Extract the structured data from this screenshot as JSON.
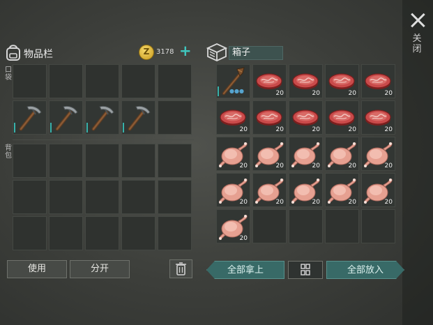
{
  "sidebar": {
    "close_label": "关闭",
    "close_icon": "close-icon"
  },
  "inventory": {
    "title": "物品栏",
    "coin_symbol": "Z",
    "coin_count": "3178",
    "add_label": "+",
    "hotbar_label": "口袋",
    "backpack_label": "背包",
    "hotbar": [
      {
        "item": "empty"
      },
      {
        "item": "empty"
      },
      {
        "item": "empty"
      },
      {
        "item": "empty"
      },
      {
        "item": "empty"
      },
      {
        "item": "pickaxe-icon",
        "durability": 1.0
      },
      {
        "item": "pickaxe-icon",
        "durability": 1.0
      },
      {
        "item": "pickaxe-icon",
        "durability": 1.0
      },
      {
        "item": "pickaxe-icon",
        "durability": 1.0
      },
      {
        "item": "empty"
      }
    ],
    "backpack_slots": 15
  },
  "chest": {
    "name": "箱子",
    "items": [
      {
        "item": "hatchet-icon",
        "count": "",
        "durability": 1.0
      },
      {
        "item": "raw-meat-icon",
        "count": "20"
      },
      {
        "item": "raw-meat-icon",
        "count": "20"
      },
      {
        "item": "raw-meat-icon",
        "count": "20"
      },
      {
        "item": "raw-meat-icon",
        "count": "20"
      },
      {
        "item": "raw-meat-icon",
        "count": "20"
      },
      {
        "item": "raw-meat-icon",
        "count": "20"
      },
      {
        "item": "raw-meat-icon",
        "count": "20"
      },
      {
        "item": "raw-meat-icon",
        "count": "20"
      },
      {
        "item": "raw-meat-icon",
        "count": "20"
      },
      {
        "item": "raw-chicken-icon",
        "count": "20"
      },
      {
        "item": "raw-chicken-icon",
        "count": "20"
      },
      {
        "item": "raw-chicken-icon",
        "count": "20"
      },
      {
        "item": "raw-chicken-icon",
        "count": "20"
      },
      {
        "item": "raw-chicken-icon",
        "count": "20"
      },
      {
        "item": "raw-chicken-icon",
        "count": "20"
      },
      {
        "item": "raw-chicken-icon",
        "count": "20"
      },
      {
        "item": "raw-chicken-icon",
        "count": "20"
      },
      {
        "item": "raw-chicken-icon",
        "count": "20"
      },
      {
        "item": "raw-chicken-icon",
        "count": "20"
      },
      {
        "item": "raw-chicken-icon",
        "count": "20"
      },
      {
        "item": "empty"
      },
      {
        "item": "empty"
      },
      {
        "item": "empty"
      },
      {
        "item": "empty"
      }
    ]
  },
  "buttons": {
    "use": "使用",
    "split": "分开",
    "take_all": "全部拿上",
    "put_all": "全部放入"
  },
  "colors": {
    "accent": "#3fc6bd",
    "coin": "#e3b84a"
  }
}
